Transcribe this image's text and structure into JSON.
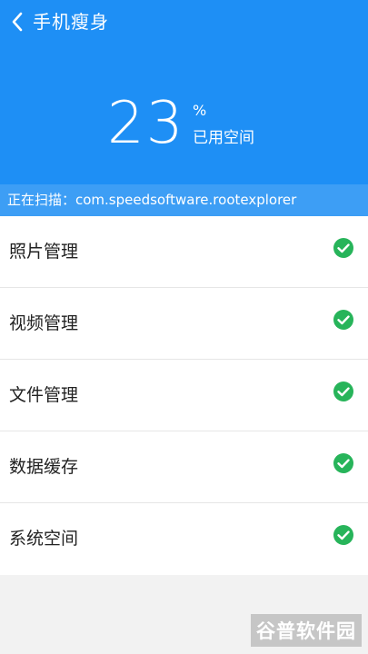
{
  "colors": {
    "header_bg": "#1e8ff5",
    "scan_bar_bg": "#3d9ef5",
    "check_green": "#27b45a"
  },
  "topbar": {
    "back_icon": "chevron-left-icon",
    "title": "手机瘦身"
  },
  "usage": {
    "value": "23",
    "unit": "%",
    "label": "已用空间"
  },
  "scan": {
    "text": "正在扫描：com.speedsoftware.rootexplorer"
  },
  "list": {
    "items": [
      {
        "label": "照片管理",
        "status_icon": "check-circle-icon"
      },
      {
        "label": "视频管理",
        "status_icon": "check-circle-icon"
      },
      {
        "label": "文件管理",
        "status_icon": "check-circle-icon"
      },
      {
        "label": "数据缓存",
        "status_icon": "check-circle-icon"
      },
      {
        "label": "系统空间",
        "status_icon": "check-circle-icon"
      }
    ]
  },
  "watermark": {
    "part1": "谷普",
    "part2": "软件园"
  }
}
